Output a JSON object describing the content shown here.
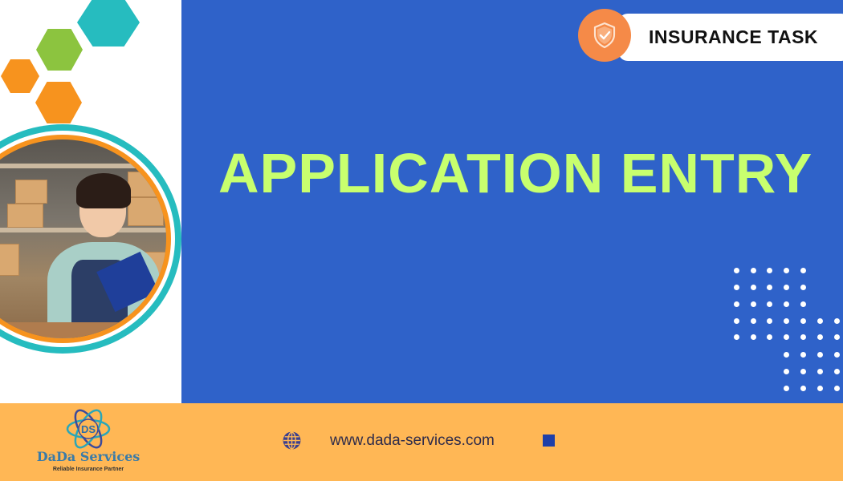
{
  "banner": {
    "title": "APPLICATION ENTRY",
    "badge": {
      "label": "INSURANCE TASK",
      "icon": "shield-check-icon"
    }
  },
  "footer": {
    "brand": {
      "monogram": "DS",
      "name": "DaDa Services",
      "tagline": "Reliable Insurance Partner"
    },
    "website": {
      "icon": "globe-icon",
      "url": "www.dada-services.com"
    }
  },
  "colors": {
    "primary_blue": "#2f62c9",
    "title_green": "#c8ff6e",
    "footer_orange": "#ffb755",
    "badge_orange": "#f58a48",
    "hex_teal": "#26bcbf",
    "hex_green": "#8cc43f",
    "hex_orange": "#f7931e"
  },
  "image": {
    "description": "Smiling woman holding a blue clipboard in a shipping office with cardboard boxes"
  }
}
